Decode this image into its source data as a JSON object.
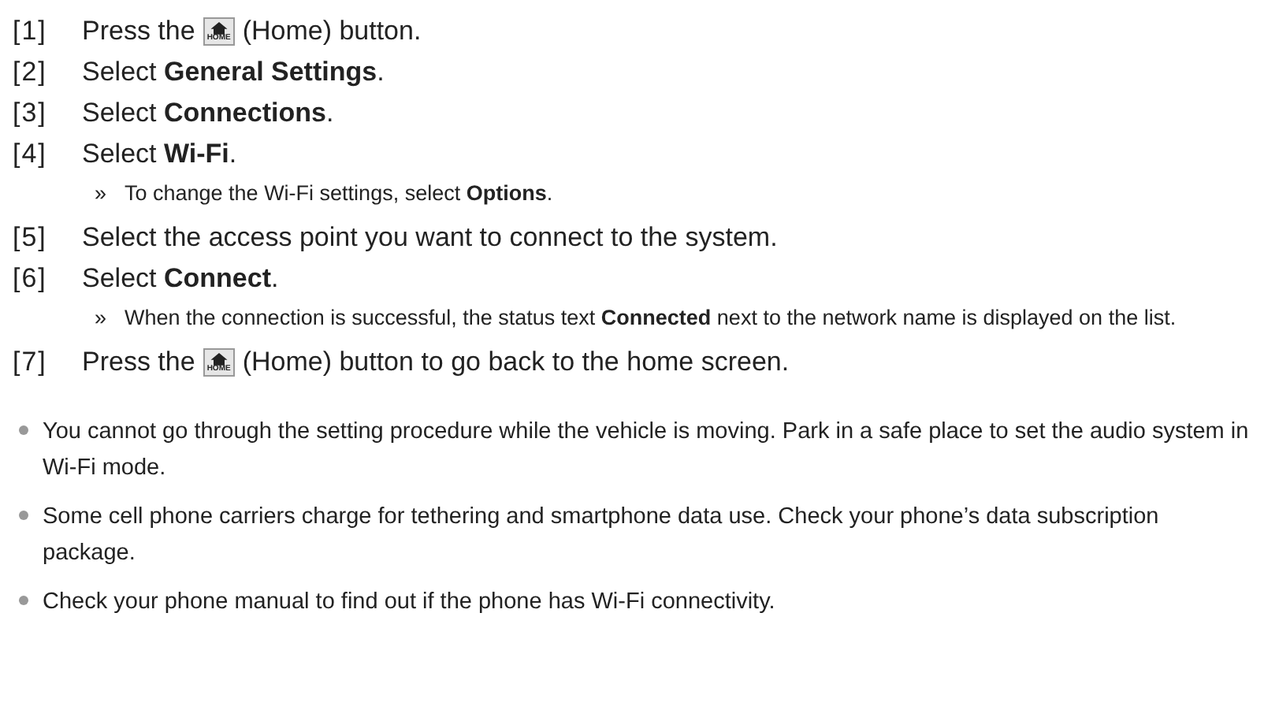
{
  "steps": [
    {
      "number": "[1]",
      "kind": "icon_text",
      "before": "Press the",
      "icon_label": "HOME",
      "after": "(Home) button."
    },
    {
      "number": "[2]",
      "kind": "text",
      "text": "Select **General Settings**."
    },
    {
      "number": "[3]",
      "kind": "text",
      "text": "Select **Connections**."
    },
    {
      "number": "[4]",
      "kind": "text",
      "text": "Select **Wi-Fi**.",
      "note": "To change the Wi-Fi settings, select **Options**."
    },
    {
      "number": "[5]",
      "kind": "text",
      "text": "Select the access point you want to connect to the system."
    },
    {
      "number": "[6]",
      "kind": "text",
      "text": "Select **Connect**.",
      "note": "When the connection is successful, the status text **Connected** next to the network name is displayed on the list."
    },
    {
      "number": "[7]",
      "kind": "icon_text",
      "before": "Press the",
      "icon_label": "HOME",
      "after": "(Home) button to go back to the home screen."
    }
  ],
  "note_marker": "»",
  "bullets": [
    "You cannot go through the setting procedure while the vehicle is moving. Park in a safe place to set the audio system in Wi-Fi mode.",
    "Some cell phone carriers charge for tethering and smartphone data use. Check your phone’s data subscription package.",
    "Check your phone manual to find out if the phone has Wi-Fi connectivity."
  ]
}
